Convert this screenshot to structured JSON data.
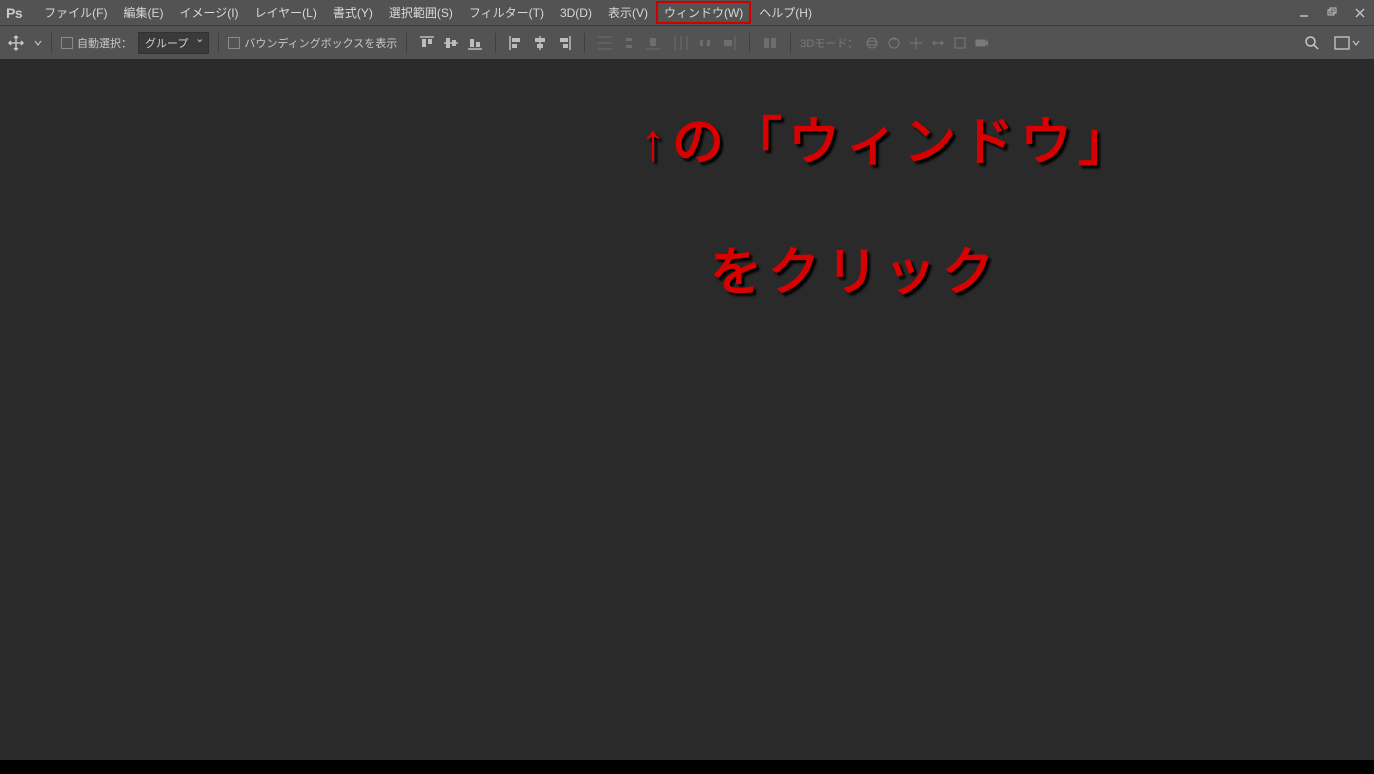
{
  "app": {
    "logo": "Ps"
  },
  "menu": {
    "items": [
      {
        "label": "ファイル(F)",
        "name": "menu-file"
      },
      {
        "label": "編集(E)",
        "name": "menu-edit"
      },
      {
        "label": "イメージ(I)",
        "name": "menu-image"
      },
      {
        "label": "レイヤー(L)",
        "name": "menu-layer"
      },
      {
        "label": "書式(Y)",
        "name": "menu-type"
      },
      {
        "label": "選択範囲(S)",
        "name": "menu-select"
      },
      {
        "label": "フィルター(T)",
        "name": "menu-filter"
      },
      {
        "label": "3D(D)",
        "name": "menu-3d"
      },
      {
        "label": "表示(V)",
        "name": "menu-view"
      },
      {
        "label": "ウィンドウ(W)",
        "name": "menu-window",
        "highlighted": true
      },
      {
        "label": "ヘルプ(H)",
        "name": "menu-help"
      }
    ]
  },
  "options": {
    "auto_select_label": "自動選択：",
    "auto_select_mode": "グループ",
    "bounding_box_label": "バウンディングボックスを表示",
    "mode3d_label": "3Dモード："
  },
  "annotation": {
    "line1": "↑の「ウィンドウ」",
    "line2": "をクリック"
  }
}
